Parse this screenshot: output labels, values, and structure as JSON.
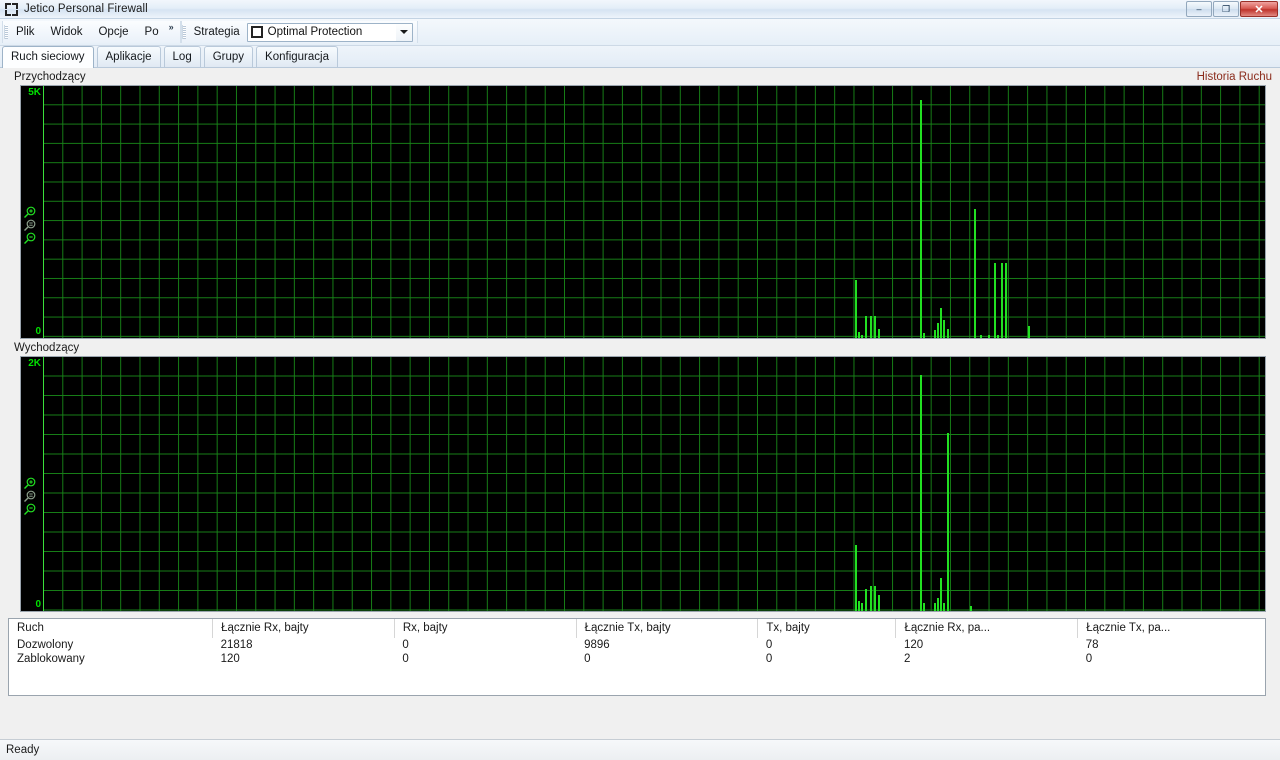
{
  "window": {
    "title": "Jetico Personal Firewall",
    "app_icon": "jetico-brackets-icon",
    "minimize_label": "–",
    "maximize_label": "❐",
    "close_label": "✕"
  },
  "menu": {
    "items": [
      "Plik",
      "Widok",
      "Opcje",
      "Po"
    ],
    "overflow_label": "»",
    "strategy_label": "Strategia",
    "strategy_value": "Optimal Protection",
    "strategy_options": [
      "Optimal Protection"
    ]
  },
  "tabs": [
    {
      "label": "Ruch sieciowy",
      "active": true
    },
    {
      "label": "Aplikacje",
      "active": false
    },
    {
      "label": "Log",
      "active": false
    },
    {
      "label": "Grupy",
      "active": false
    },
    {
      "label": "Konfiguracja",
      "active": false
    }
  ],
  "history_link": "Historia Ruchu",
  "panels": {
    "incoming_label": "Przychodzący",
    "outgoing_label": "Wychodzący"
  },
  "zoom_tools": {
    "zoom_in": "zoom-in-icon",
    "zoom_reset": "zoom-reset-icon",
    "zoom_out": "zoom-out-icon"
  },
  "table": {
    "columns": [
      "Ruch",
      "Łącznie Rx, bajty",
      "Rx, bajty",
      "Łącznie Tx, bajty",
      "Tx, bajty",
      "Łącznie Rx, pa...",
      "Łącznie Tx, pa..."
    ],
    "rows": [
      [
        "Dozwolony",
        "21818",
        "0",
        "9896",
        "0",
        "120",
        "78"
      ],
      [
        "Zablokowany",
        "120",
        "0",
        "0",
        "0",
        "2",
        "0"
      ]
    ]
  },
  "statusbar": {
    "text": "Ready"
  },
  "colors": {
    "chart_background": "#000000",
    "chart_grid": "#188418",
    "chart_axis": "#3ae03a",
    "chart_bar": "#22e022",
    "axis_text": "#00e000",
    "link": "#8b2c1c",
    "close_button": "#bf342c"
  },
  "chart_data": [
    {
      "type": "bar",
      "title": "Przychodzący",
      "xlabel": "",
      "ylabel": "",
      "ylim": [
        0,
        5000
      ],
      "ytick_labels": [
        "5K",
        "0"
      ],
      "grid": true,
      "legend": "none",
      "units": "bytes",
      "x": [
        833,
        836,
        839,
        843,
        848,
        852,
        856,
        898,
        901,
        912,
        915,
        918,
        921,
        925,
        952,
        958,
        966,
        972,
        975,
        979,
        983,
        1006
      ],
      "values": [
        1150,
        120,
        60,
        430,
        430,
        430,
        180,
        4720,
        100,
        160,
        300,
        600,
        350,
        170,
        2550,
        60,
        60,
        1480,
        60,
        1480,
        1480,
        230
      ]
    },
    {
      "type": "bar",
      "title": "Wychodzący",
      "xlabel": "",
      "ylabel": "",
      "ylim": [
        0,
        2000
      ],
      "ytick_labels": [
        "2K",
        "0"
      ],
      "grid": true,
      "legend": "none",
      "units": "bytes",
      "x": [
        833,
        836,
        839,
        843,
        848,
        852,
        856,
        898,
        901,
        912,
        915,
        918,
        921,
        925,
        948
      ],
      "values": [
        520,
        80,
        60,
        170,
        200,
        200,
        130,
        1860,
        60,
        60,
        100,
        260,
        60,
        1400,
        40
      ]
    }
  ]
}
